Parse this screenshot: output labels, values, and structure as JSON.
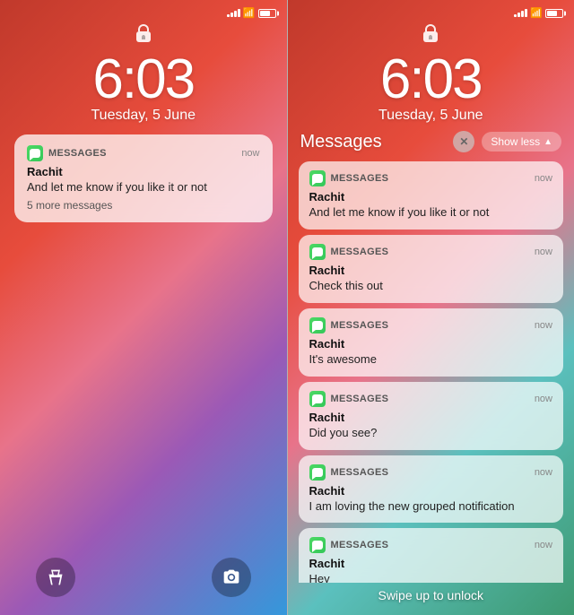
{
  "left": {
    "time": "6:03",
    "date": "Tuesday, 5 June",
    "notification": {
      "app_name": "MESSAGES",
      "time": "now",
      "sender": "Rachit",
      "body": "And let me know if you like it or not",
      "more": "5 more messages"
    },
    "controls": {
      "flashlight_label": "flashlight",
      "camera_label": "camera"
    }
  },
  "right": {
    "time": "6:03",
    "date": "Tuesday, 5 June",
    "expanded_label": "Messages",
    "show_less": "Show less",
    "swipe_label": "Swipe up to unlock",
    "notifications": [
      {
        "app_name": "MESSAGES",
        "time": "now",
        "sender": "Rachit",
        "body": "And let me know if you like it or not"
      },
      {
        "app_name": "MESSAGES",
        "time": "now",
        "sender": "Rachit",
        "body": "Check this out"
      },
      {
        "app_name": "MESSAGES",
        "time": "now",
        "sender": "Rachit",
        "body": "It's awesome"
      },
      {
        "app_name": "MESSAGES",
        "time": "now",
        "sender": "Rachit",
        "body": "Did you see?"
      },
      {
        "app_name": "MESSAGES",
        "time": "now",
        "sender": "Rachit",
        "body": "I am loving the new grouped notification"
      },
      {
        "app_name": "MESSAGES",
        "time": "now",
        "sender": "Rachit",
        "body": "Hey"
      }
    ]
  }
}
